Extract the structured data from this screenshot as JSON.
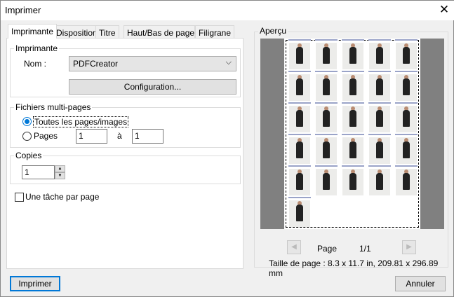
{
  "window": {
    "title": "Imprimer",
    "close": "✕"
  },
  "tabs": [
    "Imprimante",
    "Disposition",
    "Titre",
    "Haut/Bas de page",
    "Filigrane"
  ],
  "printer": {
    "group": "Imprimante",
    "name_label": "Nom :",
    "name_value": "PDFCreator",
    "config": "Configuration..."
  },
  "multipage": {
    "group": "Fichiers multi-pages",
    "all": "Toutes les pages/images",
    "pages": "Pages",
    "from": "1",
    "to_label": "à",
    "to": "1"
  },
  "copies": {
    "group": "Copies",
    "value": "1"
  },
  "one_job": "Une tâche par page",
  "preview": {
    "group": "Aperçu",
    "page_label": "Page",
    "page_value": "1/1",
    "size": "Taille de page : 8.3 x 11.7 in, 209.81 x 296.89 mm",
    "thumbnail_count": 26
  },
  "buttons": {
    "print": "Imprimer",
    "cancel": "Annuler"
  }
}
